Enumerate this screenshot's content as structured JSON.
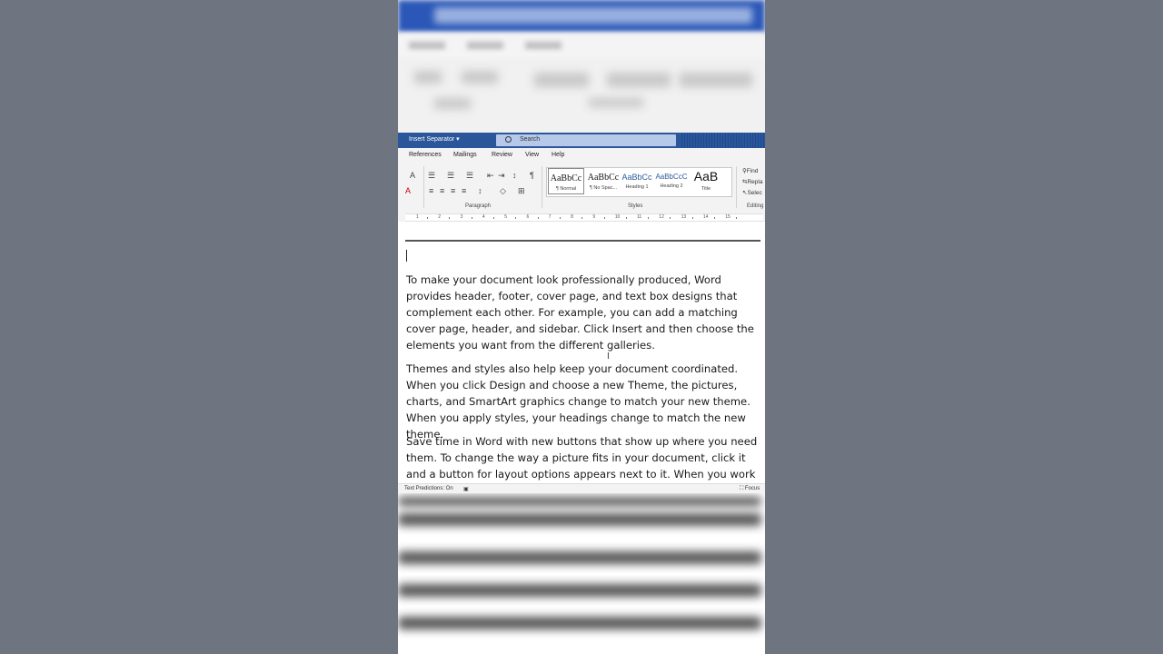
{
  "titlebar": {
    "separator_label": "Insert Separator",
    "separator_caret": "▾",
    "search_placeholder": "Search"
  },
  "tabs": [
    "References",
    "Mailings",
    "Review",
    "View",
    "Help"
  ],
  "ribbon": {
    "paragraph_label": "Paragraph",
    "styles_label": "Styles",
    "editing_label": "Editing",
    "styles": [
      {
        "sample": "AaBbCc",
        "name": "¶ Normal"
      },
      {
        "sample": "AaBbCc",
        "name": "¶ No Spac..."
      },
      {
        "sample": "AaBbCc",
        "name": "Heading 1"
      },
      {
        "sample": "AaBbCcC",
        "name": "Heading 2"
      },
      {
        "sample": "AaB",
        "name": "Title"
      }
    ],
    "editing": {
      "find": "Find",
      "replace": "Repla",
      "select": "Selec"
    }
  },
  "ruler_numbers": [
    "1",
    "2",
    "3",
    "4",
    "5",
    "6",
    "7",
    "8",
    "9",
    "10",
    "11",
    "12",
    "13",
    "14",
    "15"
  ],
  "document": {
    "paragraphs": [
      "To make your document look professionally produced, Word provides header, footer, cover page, and text box designs that complement each other. For example, you can add a matching cover page, header, and sidebar. Click Insert and then choose the elements you want from the different galleries.",
      "Themes and styles also help keep your document coordinated. When you click Design and choose a new Theme, the pictures, charts, and SmartArt graphics change to match your new theme. When you apply styles, your headings change to match the new theme.",
      "Save time in Word with new buttons that show up where you need them. To change the way a picture fits in your document, click it and a button for layout options appears next to it. When you work on a"
    ]
  },
  "status": {
    "text_predictions": "Text Predictions: On",
    "focus": "Focus"
  }
}
